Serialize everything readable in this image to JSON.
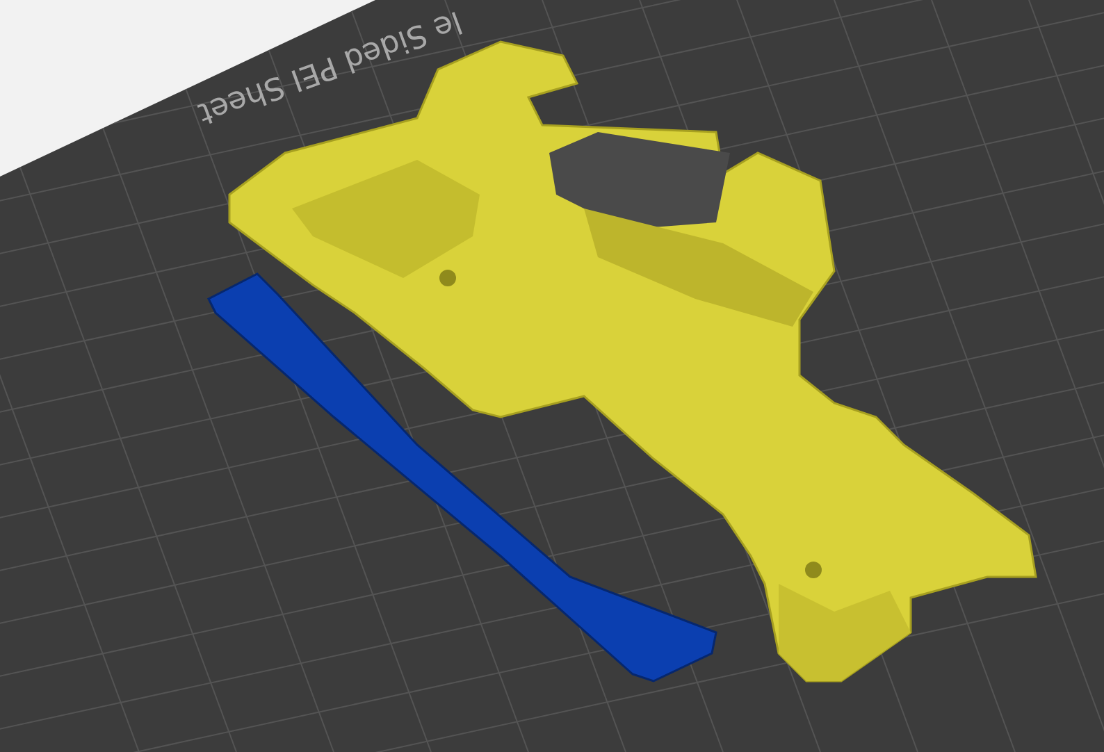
{
  "bed": {
    "label": "le Sided PEI Sheet"
  },
  "parts": [
    {
      "kind": "bracket",
      "color": "#d9d23a"
    },
    {
      "kind": "bar",
      "color": "#0b3fb0"
    }
  ]
}
